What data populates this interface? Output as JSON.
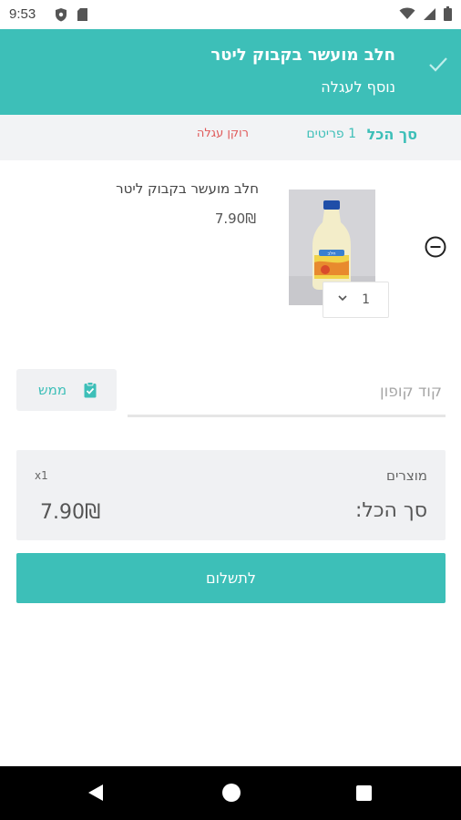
{
  "status_bar": {
    "time": "9:53"
  },
  "toast": {
    "title": "חלב מועשר בקבוק ליטר",
    "subtitle": "נוסף לעגלה"
  },
  "cart_summary": {
    "total_label": "סך הכל",
    "items_count": "1 פריטים",
    "empty_cart": "רוקן עגלה"
  },
  "cart_item": {
    "name": "חלב מועשר בקבוק ליטר",
    "price": "7.90₪",
    "quantity": "1",
    "image_label": "חלב"
  },
  "coupon": {
    "placeholder": "קוד קופון",
    "redeem_label": "ממש"
  },
  "totals": {
    "products_label": "מוצרים",
    "products_qty": "x1",
    "total_label": "סך הכל:",
    "total_value": "7.90₪"
  },
  "checkout": {
    "pay_label": "לתשלום"
  },
  "colors": {
    "accent": "#3dbfb8",
    "danger": "#e05a5a",
    "panel": "#f0f1f3"
  },
  "icons": {
    "status": [
      "shield-icon",
      "sd-card-icon",
      "wifi-icon",
      "signal-icon",
      "battery-icon"
    ],
    "toast": "check-icon",
    "remove": "minus-circle-icon",
    "quantity": "chevron-down-icon",
    "redeem": "clipboard-check-icon",
    "nav": [
      "back-icon",
      "home-icon",
      "recents-icon"
    ]
  }
}
